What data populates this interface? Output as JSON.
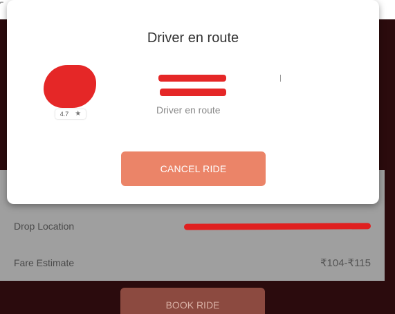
{
  "modal": {
    "title": "Driver en route",
    "driver": {
      "rating": "4.7",
      "rating_icon": "star-icon",
      "status": "Driver en route"
    },
    "cancel_button": "CANCEL RIDE"
  },
  "background": {
    "drop_location_label": "Drop Location",
    "fare_estimate_label": "Fare Estimate",
    "fare_estimate_value": "₹104-₹115",
    "book_button": "BOOK RIDE"
  },
  "colors": {
    "accent": "#eb8468",
    "redaction": "#e52727"
  }
}
